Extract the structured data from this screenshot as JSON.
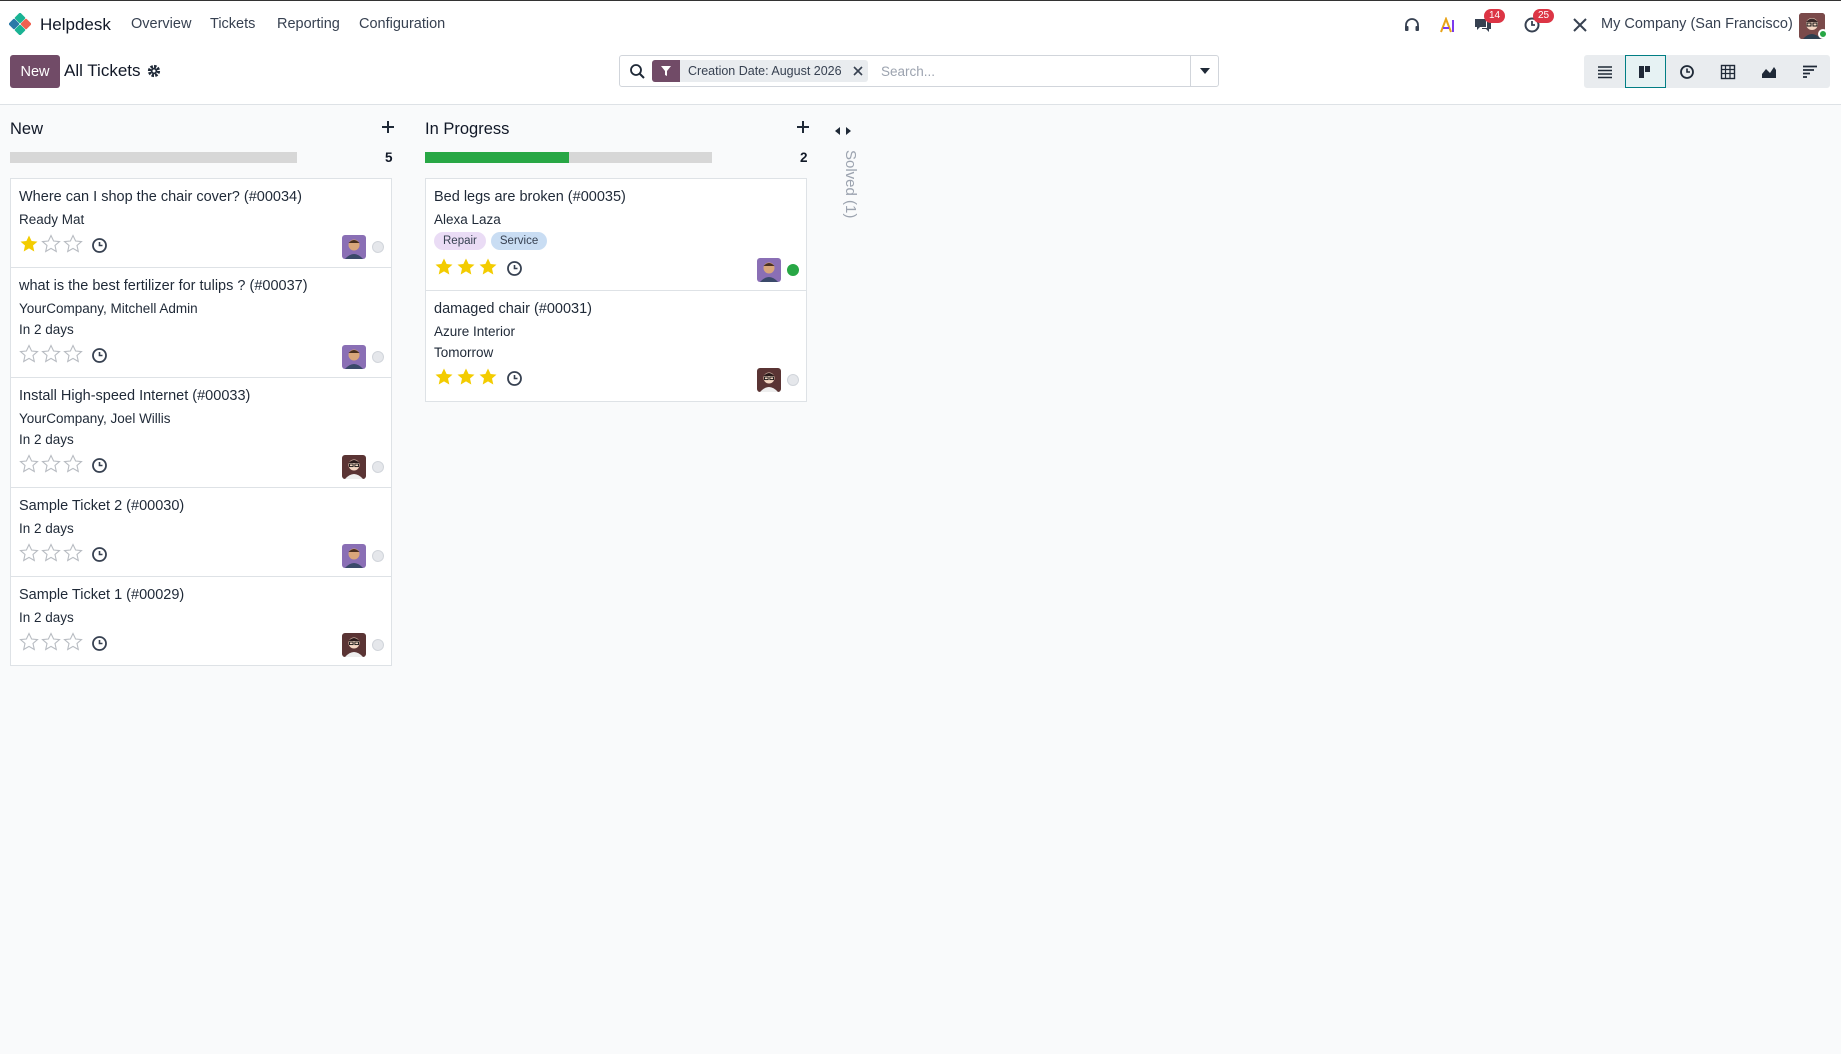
{
  "app": {
    "name": "Helpdesk"
  },
  "menu": [
    {
      "label": "Overview"
    },
    {
      "label": "Tickets"
    },
    {
      "label": "Reporting"
    },
    {
      "label": "Configuration"
    }
  ],
  "systray": {
    "messages_count": "14",
    "activities_count": "25",
    "company": "My Company (San Francisco)"
  },
  "control_panel": {
    "new_label": "New",
    "title": "All Tickets",
    "facet_label": "Creation Date: August 2026",
    "search_placeholder": "Search...",
    "views": [
      "list-icon",
      "kanban-icon",
      "activity-icon",
      "pivot-icon",
      "graph-icon",
      "cohort-icon"
    ],
    "active_view": "kanban-icon"
  },
  "colors": {
    "brand": "#714b67",
    "accent": "#017e84",
    "success": "#28a745",
    "star": "#f3cc00"
  },
  "columns": [
    {
      "title": "New",
      "count": "5",
      "progress_done": 0,
      "cards": [
        {
          "title": "Where can I shop the chair cover? (#00034)",
          "lines": [
            "Ready Mat"
          ],
          "stars": 1,
          "avatar": "purple",
          "state": "normal"
        },
        {
          "title": "what is the best fertilizer for tulips ? (#00037)",
          "lines": [
            "YourCompany, Mitchell Admin",
            "In 2 days"
          ],
          "stars": 0,
          "avatar": "purple",
          "state": "normal"
        },
        {
          "title": "Install High-speed Internet (#00033)",
          "lines": [
            "YourCompany, Joel Willis",
            "In 2 days"
          ],
          "stars": 0,
          "avatar": "dark",
          "state": "normal"
        },
        {
          "title": "Sample Ticket 2 (#00030)",
          "lines": [
            "In 2 days"
          ],
          "stars": 0,
          "avatar": "purple",
          "state": "normal"
        },
        {
          "title": "Sample Ticket 1 (#00029)",
          "lines": [
            "In 2 days"
          ],
          "stars": 0,
          "avatar": "dark",
          "state": "normal"
        }
      ]
    },
    {
      "title": "In Progress",
      "count": "2",
      "progress_done": 0.5,
      "cards": [
        {
          "title": "Bed legs are broken (#00035)",
          "lines": [
            "Alexa Laza"
          ],
          "tags": [
            "Repair",
            "Service"
          ],
          "stars": 3,
          "avatar": "purple",
          "state": "done"
        },
        {
          "title": "damaged chair (#00031)",
          "lines": [
            "Azure Interior",
            "Tomorrow"
          ],
          "stars": 3,
          "avatar": "dark",
          "state": "normal"
        }
      ]
    }
  ],
  "folded_column": {
    "label": "Solved (1)"
  }
}
